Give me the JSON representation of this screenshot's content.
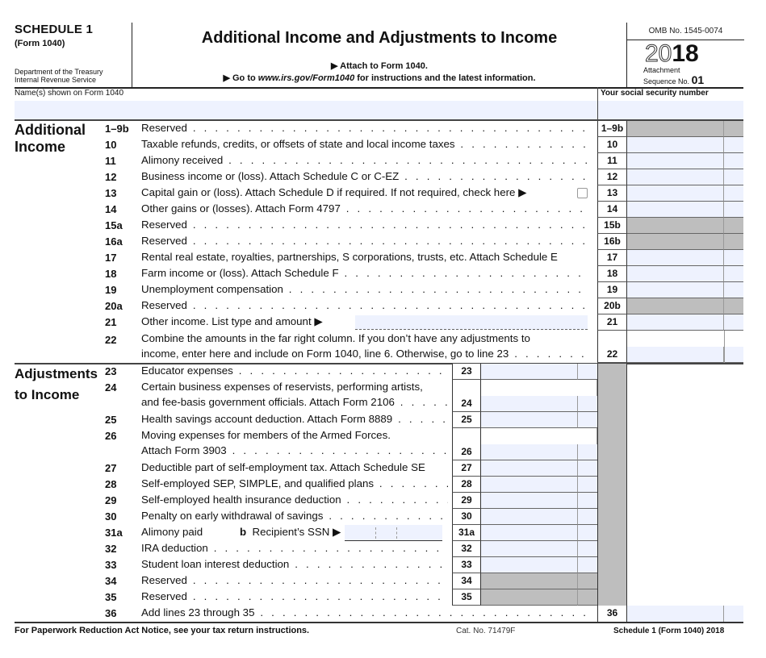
{
  "header": {
    "schedule": "SCHEDULE 1",
    "form": "(Form 1040)",
    "dept_line1": "Department of the Treasury",
    "dept_line2": "Internal Revenue Service",
    "title": "Additional Income and Adjustments to Income",
    "attach": "▶ Attach to Form 1040.",
    "goto_prefix": "▶ Go to ",
    "goto_url": "www.irs.gov/Form1040",
    "goto_suffix": " for instructions and the latest information.",
    "omb": "OMB No. 1545-0074",
    "year_outline": "20",
    "year_bold": "18",
    "attachment_label": "Attachment",
    "sequence_label": "Sequence No.",
    "sequence_no": "01"
  },
  "identity": {
    "name_label": "Name(s) shown on Form 1040",
    "name_value": "",
    "ssn_label": "Your social security number",
    "ssn_value": ""
  },
  "sections": {
    "income_line1": "Additional",
    "income_line2": "Income",
    "adjust_line1": "Adjustments",
    "adjust_line2": "to Income"
  },
  "income_lines": [
    {
      "num": "1–9b",
      "box": "1–9b",
      "desc": "Reserved",
      "dots": true,
      "shaded": true
    },
    {
      "num": "10",
      "box": "10",
      "desc": "Taxable refunds, credits, or offsets of state and local income taxes",
      "dots": true,
      "shaded": false
    },
    {
      "num": "11",
      "box": "11",
      "desc": "Alimony received",
      "dots": true,
      "shaded": false
    },
    {
      "num": "12",
      "box": "12",
      "desc": "Business income or (loss). Attach Schedule C or C-EZ",
      "dots": true,
      "shaded": false
    },
    {
      "num": "13",
      "box": "13",
      "desc": "Capital gain or (loss). Attach Schedule D if required. If not required, check here ▶",
      "dots": false,
      "shaded": false,
      "checkbox": true
    },
    {
      "num": "14",
      "box": "14",
      "desc": "Other gains or (losses). Attach Form 4797",
      "dots": true,
      "shaded": false
    },
    {
      "num": "15a",
      "box": "15b",
      "desc": "Reserved",
      "dots": true,
      "shaded": true
    },
    {
      "num": "16a",
      "box": "16b",
      "desc": "Reserved",
      "dots": true,
      "shaded": true
    },
    {
      "num": "17",
      "box": "17",
      "desc": "Rental real estate, royalties, partnerships, S corporations, trusts, etc. Attach Schedule E",
      "dots": false,
      "shaded": false
    },
    {
      "num": "18",
      "box": "18",
      "desc": "Farm income or (loss). Attach Schedule F",
      "dots": true,
      "shaded": false
    },
    {
      "num": "19",
      "box": "19",
      "desc": "Unemployment compensation",
      "dots": true,
      "shaded": false
    },
    {
      "num": "20a",
      "box": "20b",
      "desc": "Reserved",
      "dots": true,
      "shaded": true
    },
    {
      "num": "21",
      "box": "21",
      "desc": "Other income. List type and amount ▶",
      "dots": false,
      "shaded": false
    }
  ],
  "line22": {
    "num": "22",
    "box": "22",
    "desc_line1": "Combine the amounts in the far right column. If you don’t have any adjustments to",
    "desc_line2": "income, enter here and include on Form 1040, line 6. Otherwise, go to line 23"
  },
  "adjust_lines": [
    {
      "num": "23",
      "box": "23",
      "desc": [
        "Educator expenses"
      ],
      "shaded": false
    },
    {
      "num": "24",
      "box": "24",
      "desc": [
        "Certain business expenses of reservists, performing artists,",
        "and fee-basis government officials. Attach Form 2106"
      ],
      "shaded": false
    },
    {
      "num": "25",
      "box": "25",
      "desc": [
        "Health savings account deduction. Attach Form 8889"
      ],
      "shaded": false
    },
    {
      "num": "26",
      "box": "26",
      "desc": [
        "Moving expenses for members of the Armed Forces.",
        "Attach Form 3903"
      ],
      "shaded": false
    },
    {
      "num": "27",
      "box": "27",
      "desc": [
        "Deductible part of self-employment tax. Attach Schedule SE"
      ],
      "shaded": false
    },
    {
      "num": "28",
      "box": "28",
      "desc": [
        "Self-employed SEP, SIMPLE, and qualified plans"
      ],
      "shaded": false
    },
    {
      "num": "29",
      "box": "29",
      "desc": [
        "Self-employed health insurance deduction"
      ],
      "shaded": false
    },
    {
      "num": "30",
      "box": "30",
      "desc": [
        "Penalty on early withdrawal of savings"
      ],
      "shaded": false
    },
    {
      "num": "31a",
      "box": "31a",
      "desc": [
        "Alimony paid"
      ],
      "shaded": false
    },
    {
      "num": "32",
      "box": "32",
      "desc": [
        "IRA deduction"
      ],
      "shaded": false
    },
    {
      "num": "33",
      "box": "33",
      "desc": [
        "Student loan interest deduction"
      ],
      "shaded": false
    },
    {
      "num": "34",
      "box": "34",
      "desc": [
        "Reserved"
      ],
      "shaded": true
    },
    {
      "num": "35",
      "box": "35",
      "desc": [
        "Reserved"
      ],
      "shaded": true
    }
  ],
  "line31b": {
    "label_b": "b",
    "label": "Recipient’s SSN ▶",
    "value": ""
  },
  "line36": {
    "num": "36",
    "box": "36",
    "desc": "Add lines 23 through 35"
  },
  "footer": {
    "left": "For Paperwork Reduction Act Notice, see your tax return instructions.",
    "cat": "Cat. No. 71479F",
    "right": "Schedule 1 (Form 1040) 2018"
  },
  "colors": {
    "field_fill": "#eef2fe",
    "shaded": "#bebebe",
    "rule": "#222222"
  }
}
